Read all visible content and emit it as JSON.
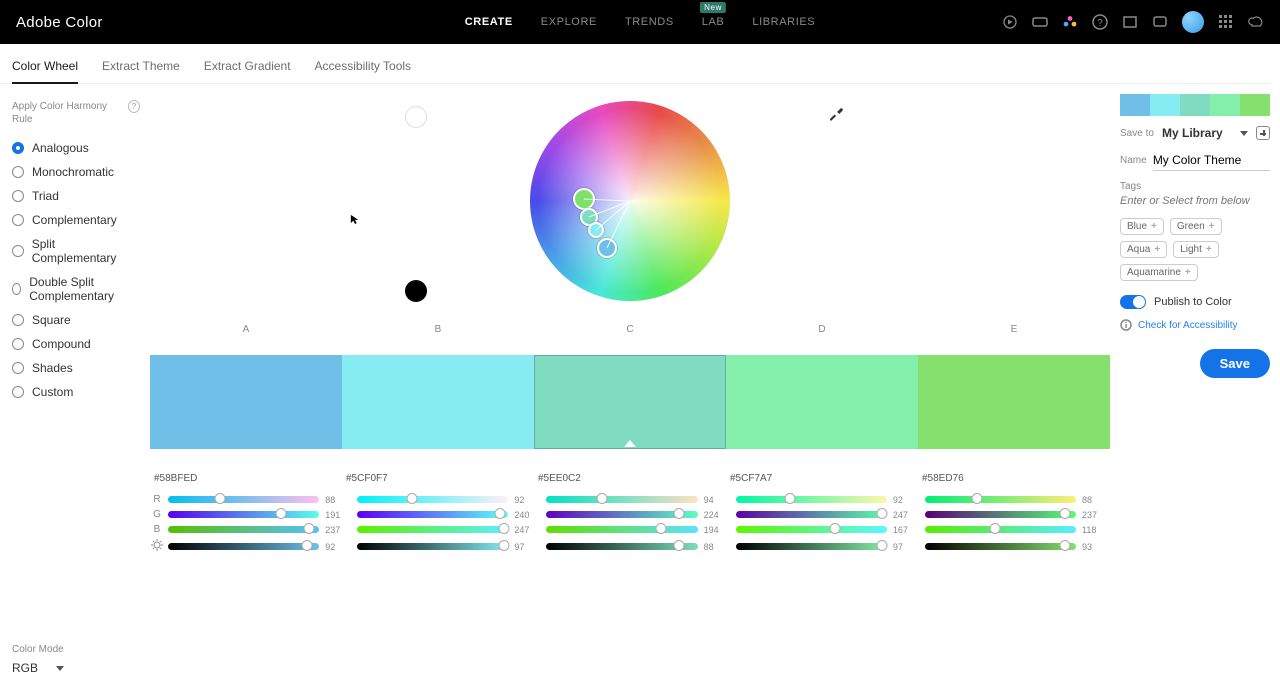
{
  "brand": "Adobe Color",
  "nav": {
    "items": [
      "CREATE",
      "EXPLORE",
      "TRENDS",
      "LAB",
      "LIBRARIES"
    ],
    "active": 0,
    "badge": "New"
  },
  "subtabs": {
    "items": [
      "Color Wheel",
      "Extract Theme",
      "Extract Gradient",
      "Accessibility Tools"
    ],
    "active": 0
  },
  "harmony": {
    "header": "Apply Color Harmony Rule",
    "rules": [
      "Analogous",
      "Monochromatic",
      "Triad",
      "Complementary",
      "Split Complementary",
      "Double Split Complementary",
      "Square",
      "Compound",
      "Shades",
      "Custom"
    ],
    "selected": 0
  },
  "colorMode": {
    "label": "Color Mode",
    "value": "RGB",
    "channels": [
      "R",
      "G",
      "B"
    ]
  },
  "swatches": {
    "labels": [
      "A",
      "B",
      "C",
      "D",
      "E"
    ],
    "selected": 2,
    "items": [
      {
        "hex": "#58BFED",
        "color": "#6fbfe8",
        "r": 88,
        "g": 191,
        "b": 237,
        "br": 92
      },
      {
        "hex": "#5CF0F7",
        "color": "#86ecf2",
        "r": 92,
        "g": 240,
        "b": 247,
        "br": 97
      },
      {
        "hex": "#5EE0C2",
        "color": "#7fdcc0",
        "r": 94,
        "g": 224,
        "b": 194,
        "br": 88
      },
      {
        "hex": "#5CF7A7",
        "color": "#84eeab",
        "r": 92,
        "g": 247,
        "b": 167,
        "br": 97
      },
      {
        "hex": "#58ED76",
        "color": "#86e06e",
        "r": 88,
        "g": 237,
        "b": 118,
        "br": 93
      }
    ]
  },
  "right": {
    "saveTo": "Save to",
    "library": "My Library",
    "nameLabel": "Name",
    "name": "My Color Theme",
    "tagsLabel": "Tags",
    "tagsPlaceholder": "Enter or Select from below",
    "chips": [
      "Blue",
      "Green",
      "Aqua",
      "Light",
      "Aquamarine"
    ],
    "publish": "Publish to Color",
    "accessibility": "Check for Accessibility",
    "save": "Save"
  }
}
